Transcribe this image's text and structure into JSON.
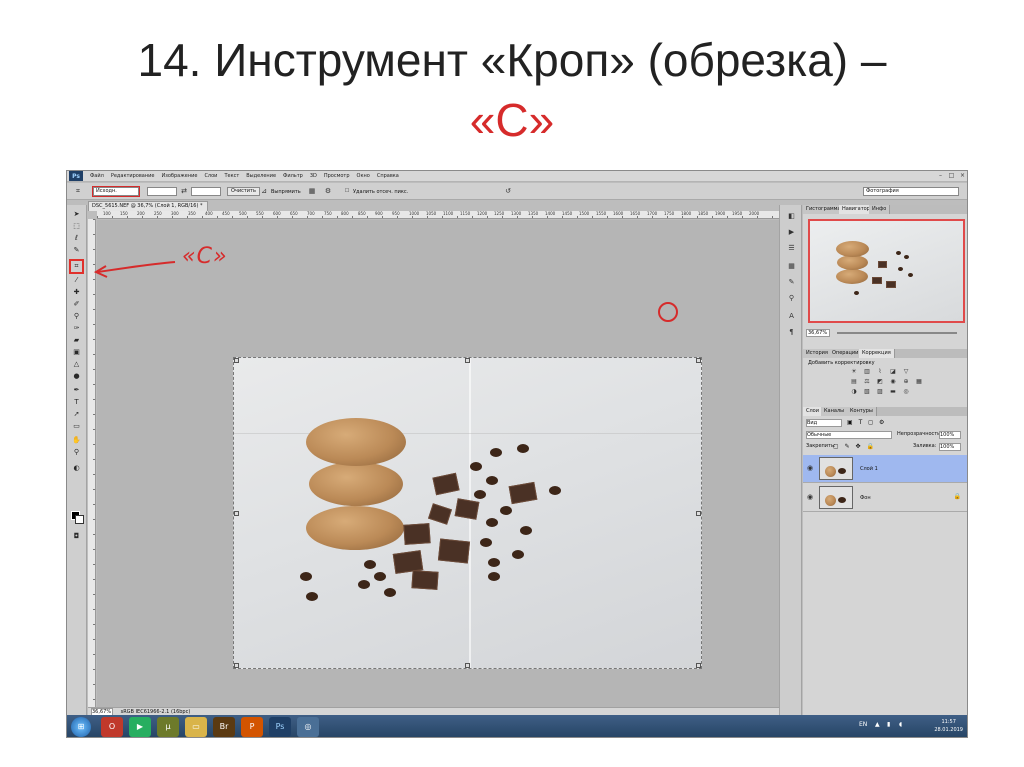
{
  "slide": {
    "title_line1": "14. Инструмент «Кроп» (обрезка) –",
    "title_line2": "«С»"
  },
  "annotation": {
    "shortcut_label": "«C»"
  },
  "photoshop": {
    "logo": "Ps",
    "menu": [
      "Файл",
      "Редактирование",
      "Изображение",
      "Слои",
      "Текст",
      "Выделение",
      "Фильтр",
      "3D",
      "Просмотр",
      "Окно",
      "Справка"
    ],
    "options_bar": {
      "ratio_select": "Исходн.",
      "clear_button": "Очистить",
      "straighten_button": "Выпрямить",
      "delete_checkbox": "Удалить отсеч. пикс.",
      "workspace_select": "Фотография"
    },
    "document_tab": "DSC_5615.NEF @ 36,7% (Слой 1, RGB/16) *",
    "ruler_ticks": [
      "100",
      "150",
      "200",
      "250",
      "300",
      "350",
      "400",
      "450",
      "500",
      "550",
      "600",
      "650",
      "700",
      "750",
      "800",
      "850",
      "900",
      "950",
      "1000",
      "1050",
      "1100",
      "1150",
      "1200",
      "1250",
      "1300",
      "1350",
      "1400",
      "1450",
      "1500",
      "1550",
      "1600",
      "1650",
      "1700",
      "1750",
      "1800",
      "1850",
      "1900",
      "1950",
      "2000"
    ],
    "status": {
      "zoom": "36,67%",
      "profile": "sRGB IEC61966-2.1 (16bpc)"
    },
    "panels": {
      "top_tabs": [
        "Гистограмма",
        "Навигатор",
        "Инфо"
      ],
      "navigator_zoom": "36,67%",
      "adj_tabs": [
        "История",
        "Операции",
        "Коррекция"
      ],
      "adj_title": "Добавить корректировку",
      "layer_tabs": [
        "Слои",
        "Каналы",
        "Контуры"
      ],
      "kind_filter": "Вид",
      "blend_mode": "Обычные",
      "opacity_label": "Непрозрачность:",
      "opacity_value": "100%",
      "lock_label": "Закрепить:",
      "fill_label": "Заливка:",
      "fill_value": "100%",
      "layers": [
        {
          "name": "Слой 1",
          "selected": true
        },
        {
          "name": "Фон",
          "selected": false
        }
      ]
    },
    "taskbar": {
      "lang": "EN",
      "time": "11:57",
      "date": "28.01.2019"
    }
  },
  "colors": {
    "accent": "#d62b2b",
    "layer_selected": "#9fb8ef",
    "taskbar": "#2b4a70"
  }
}
